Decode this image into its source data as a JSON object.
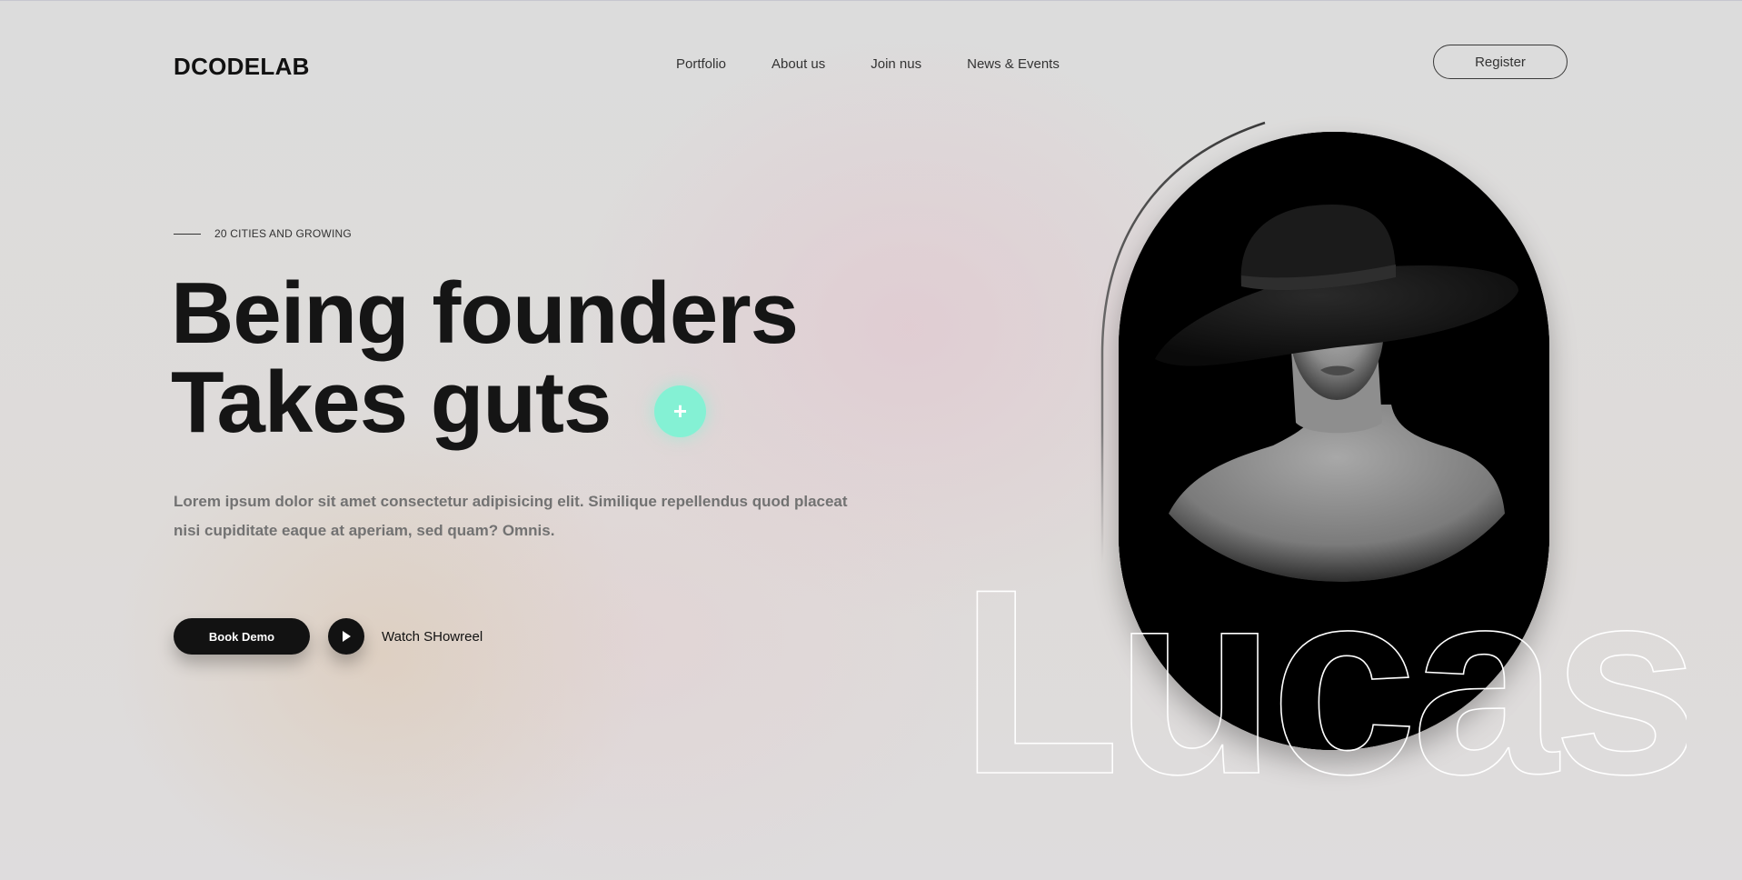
{
  "header": {
    "logo": "DCODELAB",
    "nav": [
      "Portfolio",
      "About us",
      "Join nus",
      "News & Events"
    ],
    "register_label": "Register"
  },
  "hero": {
    "eyebrow": "20 CITIES AND GROWING",
    "headline_line1": "Being founders",
    "headline_line2": "Takes guts",
    "plus_symbol": "+",
    "description": "Lorem ipsum dolor sit amet consectetur adipisicing elit. Similique repellendus quod placeat nisi cupiditate eaque at aperiam, sed quam? Omnis.",
    "book_demo_label": "Book Demo",
    "watch_label": "Watch SHowreel"
  },
  "visual": {
    "outline_name": "Lucas",
    "portrait_description_icon": "portrait-image",
    "accent_color": "#84f1d4"
  }
}
